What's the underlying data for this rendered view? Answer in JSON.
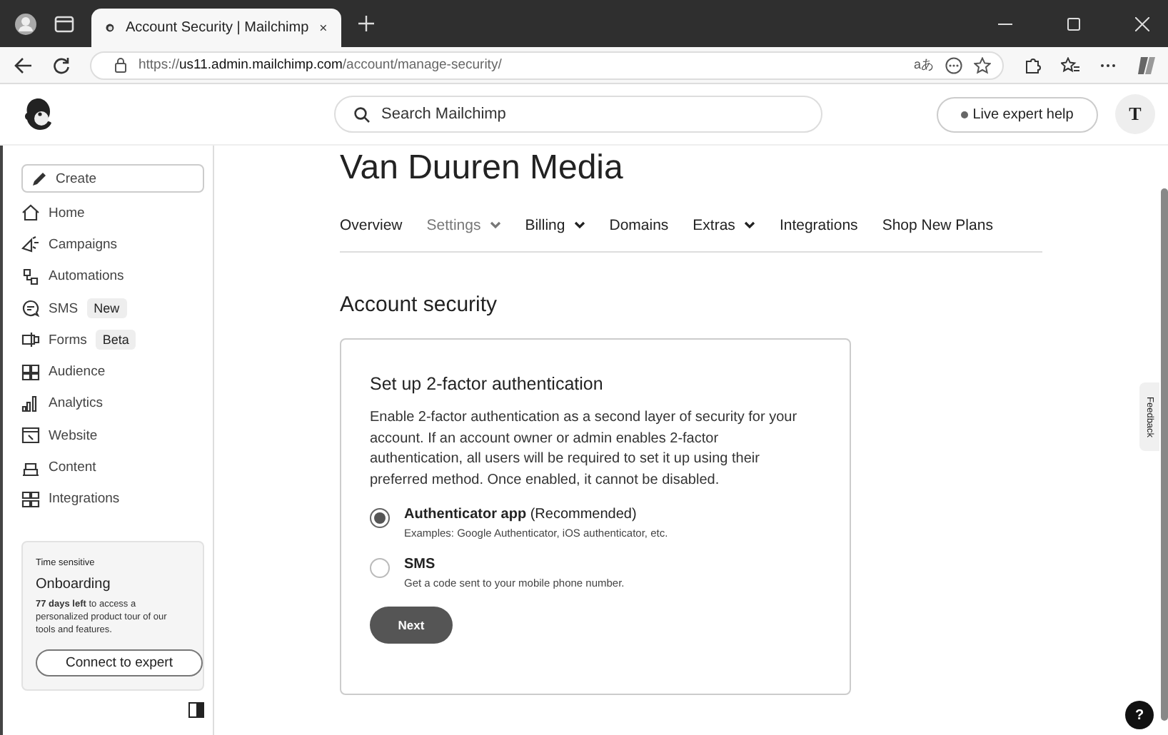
{
  "browser": {
    "tab_title": "Account Security | Mailchimp",
    "url": {
      "scheme": "https://",
      "host": "us11.admin.mailchimp.com",
      "path": "/account/manage-security/"
    },
    "read_aloud": "aあ"
  },
  "header": {
    "search": {
      "placeholder": "Search Mailchimp"
    },
    "help_button": "Live expert help",
    "avatar": "T"
  },
  "sidebar": {
    "create": "Create",
    "items": [
      {
        "label": "Home"
      },
      {
        "label": "Campaigns"
      },
      {
        "label": "Automations"
      },
      {
        "label": "SMS",
        "badge": "New"
      },
      {
        "label": "Forms",
        "badge": "Beta"
      },
      {
        "label": "Audience"
      },
      {
        "label": "Analytics"
      },
      {
        "label": "Website"
      },
      {
        "label": "Content"
      },
      {
        "label": "Integrations"
      }
    ],
    "onboarding": {
      "eyebrow": "Time sensitive",
      "title": "Onboarding",
      "text": "**77 days left** to access a personalized product tour of our tools and features.",
      "button": "Connect to expert"
    }
  },
  "page": {
    "title": "Van Duuren Media",
    "nav": [
      {
        "label": "Overview",
        "selected": false,
        "has_menu": false
      },
      {
        "label": "Settings",
        "selected": true,
        "has_menu": true
      },
      {
        "label": "Billing",
        "selected": false,
        "has_menu": true
      },
      {
        "label": "Domains",
        "selected": false,
        "has_menu": false
      },
      {
        "label": "Extras",
        "selected": false,
        "has_menu": true
      },
      {
        "label": "Integrations",
        "selected": false,
        "has_menu": false
      },
      {
        "label": "Shop New Plans",
        "selected": false,
        "has_menu": false
      }
    ],
    "section_title": "Account security",
    "card": {
      "title": "Set up 2-factor authentication",
      "text": "Enable 2-factor authentication as a second layer of security for your account. If an account owner or admin enables 2-factor authentication, all users will be required to set it up using their preferred method. Once enabled, it cannot be disabled.",
      "options": [
        {
          "label": "**Authenticator app** (Recommended)",
          "hint": "Examples: Google Authenticator, iOS authenticator, etc.",
          "selected": true
        },
        {
          "label": "**SMS**",
          "hint": "Get a code sent to your mobile phone number.",
          "selected": false
        }
      ],
      "button": "Next"
    }
  },
  "feedback": "Feedback",
  "help": "?"
}
